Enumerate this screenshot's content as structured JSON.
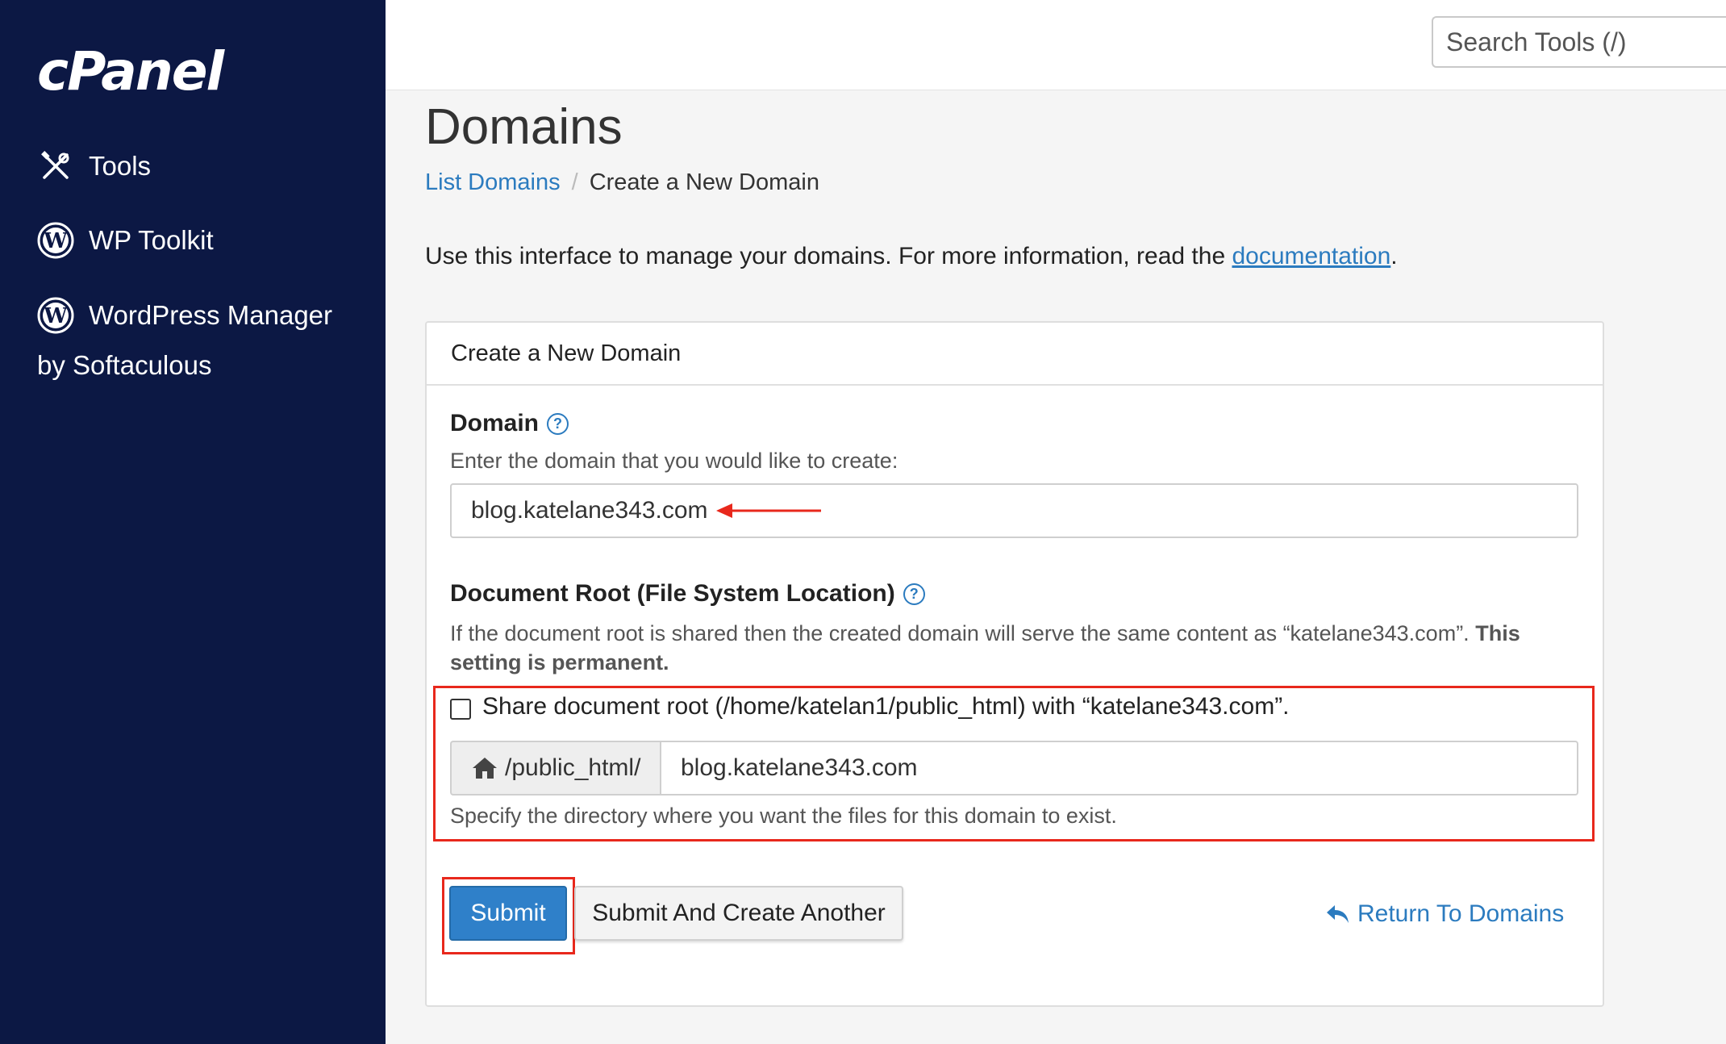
{
  "sidebar": {
    "logo": "cPanel",
    "items": [
      {
        "label": "Tools",
        "icon": "tools-icon"
      },
      {
        "label": "WP Toolkit",
        "icon": "wordpress-icon"
      },
      {
        "label": "WordPress Manager",
        "label2": "by Softaculous",
        "icon": "wordpress-icon"
      }
    ]
  },
  "topbar": {
    "search_placeholder": "Search Tools (/)"
  },
  "page": {
    "title": "Domains",
    "breadcrumb": {
      "link": "List Domains",
      "separator": "/",
      "current": "Create a New Domain"
    },
    "intro_text": "Use this interface to manage your domains. For more information, read the ",
    "intro_link": "documentation",
    "intro_end": "."
  },
  "form": {
    "panel_title": "Create a New Domain",
    "domain_label": "Domain",
    "domain_hint": "Enter the domain that you would like to create:",
    "domain_value": "blog.katelane343.com",
    "docroot_label": "Document Root (File System Location)",
    "docroot_hint_1": "If the document root is shared then the created domain will serve the same content as “katelane343.com”. ",
    "docroot_hint_bold_1": "This",
    "docroot_hint_bold_2": "setting is permanent.",
    "share_label": "Share document root (/home/katelan1/public_html) with “katelane343.com”.",
    "share_checked": false,
    "addon_prefix": "/public_html/",
    "docroot_value": "blog.katelane343.com",
    "docroot_help": "Specify the directory where you want the files for this domain to exist.",
    "submit_label": "Submit",
    "submit_another_label": "Submit And Create Another",
    "return_label": "Return To Domains"
  },
  "colors": {
    "sidebar_bg": "#0c1844",
    "link": "#2b7bbf",
    "primary": "#2f80c9",
    "highlight": "#e8281c"
  }
}
